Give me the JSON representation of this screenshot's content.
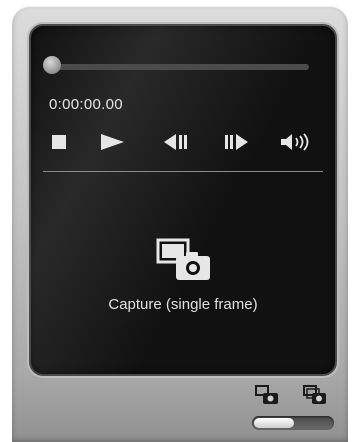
{
  "player": {
    "timecode": "0:00:00.00",
    "seek_progress": 0.0
  },
  "controls": {
    "stop_icon": "stop-icon",
    "play_icon": "play-icon",
    "prev_frame_icon": "previous-frame-icon",
    "next_frame_icon": "next-frame-icon",
    "volume_icon": "volume-icon"
  },
  "capture": {
    "label": "Capture (single frame)",
    "icon": "camera-frame-icon"
  },
  "bottom_bar": {
    "single_capture_icon": "single-frame-capture-icon",
    "multi_capture_icon": "multi-frame-capture-icon"
  },
  "colors": {
    "screen_bg": "#111111",
    "text": "#e6e6e6",
    "body_light": "#dcdcdc",
    "body_dark": "#909090"
  }
}
